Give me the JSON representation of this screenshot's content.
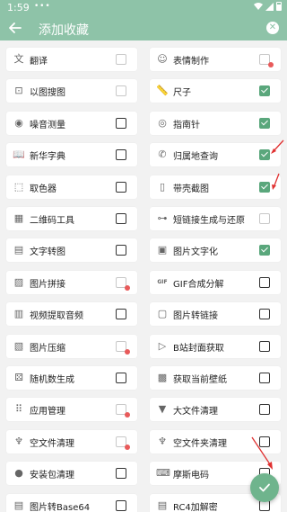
{
  "status_bar": {
    "time": "1:59",
    "dots": "• • •"
  },
  "app_bar": {
    "title": "添加收藏",
    "back_icon": "back-arrow-icon",
    "clear_icon": "close-circle-icon"
  },
  "colors": {
    "primary": "#8ec3a8",
    "check": "#5aa77c",
    "badge": "#e85a5a",
    "annotation": "#e03030"
  },
  "tools": [
    {
      "label": "翻译",
      "icon": "translate-icon",
      "glyph": "文",
      "state": "disabled",
      "badge": false
    },
    {
      "label": "表情制作",
      "icon": "smiley-icon",
      "glyph": "☺",
      "state": "disabled",
      "badge": true
    },
    {
      "label": "以图搜图",
      "icon": "image-search-icon",
      "glyph": "⊡",
      "state": "disabled",
      "badge": false
    },
    {
      "label": "尺子",
      "icon": "ruler-icon",
      "glyph": "📏",
      "state": "checked",
      "badge": false
    },
    {
      "label": "噪音测量",
      "icon": "noise-icon",
      "glyph": "◉",
      "state": "unchecked",
      "badge": false
    },
    {
      "label": "指南针",
      "icon": "compass-icon",
      "glyph": "◎",
      "state": "checked",
      "badge": false
    },
    {
      "label": "新华字典",
      "icon": "dictionary-icon",
      "glyph": "📖",
      "state": "unchecked",
      "badge": false
    },
    {
      "label": "归属地查询",
      "icon": "phone-icon",
      "glyph": "✆",
      "state": "checked",
      "badge": false
    },
    {
      "label": "取色器",
      "icon": "color-picker-icon",
      "glyph": "⬚",
      "state": "unchecked",
      "badge": false
    },
    {
      "label": "带壳截图",
      "icon": "phone-frame-icon",
      "glyph": "▯",
      "state": "checked",
      "badge": false
    },
    {
      "label": "二维码工具",
      "icon": "qr-code-icon",
      "glyph": "▦",
      "state": "unchecked",
      "badge": false
    },
    {
      "label": "短链接生成与还原",
      "icon": "link-icon",
      "glyph": "⊶",
      "state": "disabled",
      "badge": false
    },
    {
      "label": "文字转图",
      "icon": "text-image-icon",
      "glyph": "▤",
      "state": "unchecked",
      "badge": false
    },
    {
      "label": "图片文字化",
      "icon": "image-text-icon",
      "glyph": "▣",
      "state": "checked",
      "badge": false
    },
    {
      "label": "图片拼接",
      "icon": "image-join-icon",
      "glyph": "▨",
      "state": "disabled",
      "badge": true
    },
    {
      "label": "GIF合成分解",
      "icon": "gif-icon",
      "glyph": "GIF",
      "state": "unchecked",
      "badge": false
    },
    {
      "label": "视频提取音频",
      "icon": "video-audio-icon",
      "glyph": "▥",
      "state": "unchecked",
      "badge": false
    },
    {
      "label": "图片转链接",
      "icon": "image-link-icon",
      "glyph": "▢",
      "state": "unchecked",
      "badge": false
    },
    {
      "label": "图片压缩",
      "icon": "image-compress-icon",
      "glyph": "▧",
      "state": "disabled",
      "badge": true
    },
    {
      "label": "B站封面获取",
      "icon": "bilibili-icon",
      "glyph": "▷",
      "state": "unchecked",
      "badge": false
    },
    {
      "label": "随机数生成",
      "icon": "dice-icon",
      "glyph": "⚄",
      "state": "unchecked",
      "badge": false
    },
    {
      "label": "获取当前壁纸",
      "icon": "wallpaper-icon",
      "glyph": "▩",
      "state": "unchecked",
      "badge": false
    },
    {
      "label": "应用管理",
      "icon": "apps-grid-icon",
      "glyph": "⠿",
      "state": "disabled",
      "badge": true
    },
    {
      "label": "大文件清理",
      "icon": "file-clean-icon",
      "glyph": "▼",
      "state": "unchecked",
      "badge": false
    },
    {
      "label": "空文件清理",
      "icon": "broom-icon",
      "glyph": "♆",
      "state": "disabled",
      "badge": true
    },
    {
      "label": "空文件夹清理",
      "icon": "broom-folder-icon",
      "glyph": "♆",
      "state": "unchecked",
      "badge": false
    },
    {
      "label": "安装包清理",
      "icon": "package-icon",
      "glyph": "●",
      "state": "unchecked",
      "badge": false
    },
    {
      "label": "摩斯电码",
      "icon": "morse-icon",
      "glyph": "⌨",
      "state": "unchecked",
      "badge": false
    },
    {
      "label": "图片转Base64",
      "icon": "base64-icon",
      "glyph": "▤",
      "state": "unchecked",
      "badge": false
    },
    {
      "label": "RC4加解密",
      "icon": "lock-icon",
      "glyph": "▤",
      "state": "unchecked",
      "badge": false
    }
  ],
  "fab": {
    "icon": "check-icon"
  }
}
